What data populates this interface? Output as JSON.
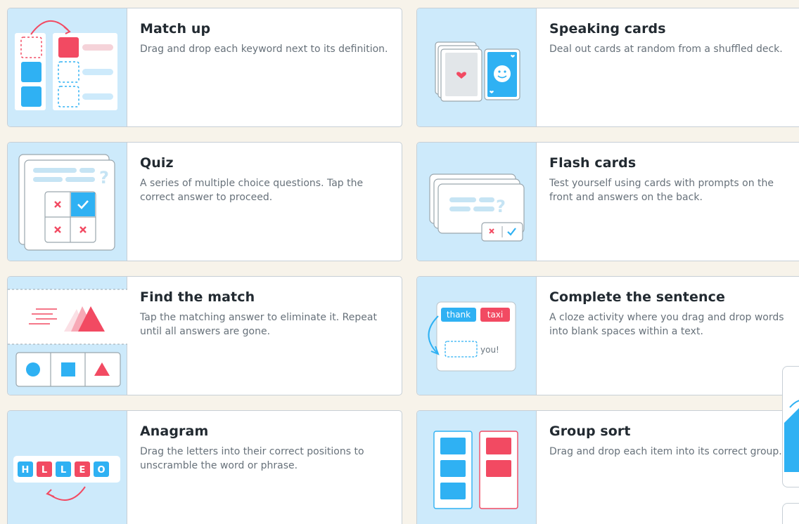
{
  "activities": [
    {
      "title": "Match up",
      "description": "Drag and drop each keyword next to its definition."
    },
    {
      "title": "Speaking cards",
      "description": "Deal out cards at random from a shuffled deck."
    },
    {
      "title": "Quiz",
      "description": "A series of multiple choice questions. Tap the correct answer to proceed."
    },
    {
      "title": "Flash cards",
      "description": "Test yourself using cards with prompts on the front and answers on the back."
    },
    {
      "title": "Find the match",
      "description": "Tap the matching answer to eliminate it. Repeat until all answers are gone."
    },
    {
      "title": "Complete the sentence",
      "description": "A cloze activity where you drag and drop words into blank spaces within a text."
    },
    {
      "title": "Anagram",
      "description": "Drag the letters into their correct positions to unscramble the word or phrase."
    },
    {
      "title": "Group sort",
      "description": "Drag and drop each item into its correct group."
    }
  ],
  "thumb_text": {
    "sentence_word_1": "thank",
    "sentence_word_2": "taxi",
    "sentence_tail": "you!",
    "anagram_letters": [
      "H",
      "L",
      "L",
      "E",
      "O"
    ]
  },
  "colors": {
    "blue": "#2fb1f3",
    "red": "#f24a62",
    "thumb_bg": "#cdeafb"
  }
}
